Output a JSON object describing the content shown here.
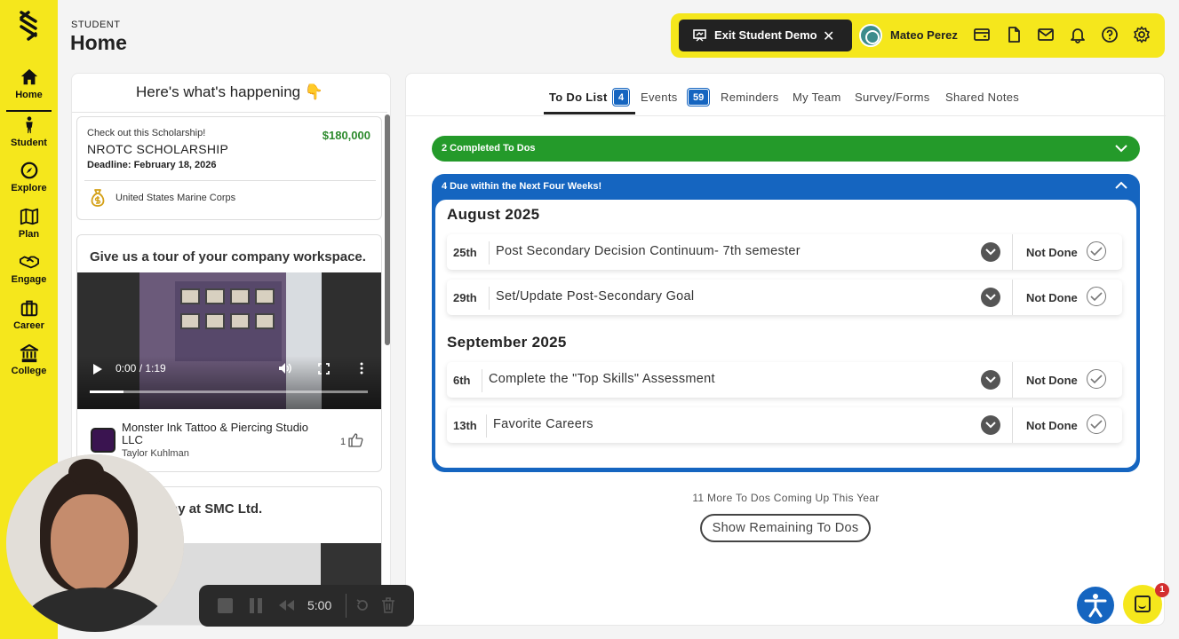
{
  "sidebar": {
    "items": [
      {
        "label": "Home",
        "icon": "home-icon"
      },
      {
        "label": "Student",
        "icon": "person-icon"
      },
      {
        "label": "Explore",
        "icon": "compass-icon"
      },
      {
        "label": "Plan",
        "icon": "map-icon"
      },
      {
        "label": "Engage",
        "icon": "handshake-icon"
      },
      {
        "label": "Career",
        "icon": "briefcase-icon"
      },
      {
        "label": "College",
        "icon": "building-icon"
      }
    ]
  },
  "header": {
    "section": "STUDENT",
    "title": "Home"
  },
  "topbar": {
    "exit_label": "Exit Student Demo",
    "user_name": "Mateo Perez"
  },
  "feed": {
    "title": "Here's what's happening 👇",
    "scholarship": {
      "kicker": "Check out this Scholarship!",
      "name": "NROTC SCHOLARSHIP",
      "deadline": "Deadline: February 18, 2026",
      "amount": "$180,000",
      "org": "United States Marine Corps"
    },
    "video1": {
      "title": "Give us a tour of your company workspace.",
      "time": "0:00 / 1:19",
      "progress": 0.12,
      "company": "Monster Ink Tattoo & Piercing Studio LLC",
      "author": "Taylor Kuhlman",
      "likes": "1"
    },
    "video2": {
      "title": "ypical workday at SMC Ltd."
    }
  },
  "tabs": [
    {
      "label": "To Do List",
      "badge": "4",
      "active": true
    },
    {
      "label": "Events",
      "badge": "59"
    },
    {
      "label": "Reminders"
    },
    {
      "label": "My Team"
    },
    {
      "label": "Survey/Forms"
    },
    {
      "label": "Shared Notes"
    }
  ],
  "todo": {
    "completed_label": "2 Completed To Dos",
    "due_label": "4 Due within the Next Four Weeks!",
    "months": [
      {
        "name": "August 2025",
        "items": [
          {
            "day": "25th",
            "title": "Post Secondary Decision Continuum- 7th semester",
            "status": "Not Done"
          },
          {
            "day": "29th",
            "title": "Set/Update Post-Secondary Goal",
            "status": "Not Done"
          }
        ]
      },
      {
        "name": "September 2025",
        "items": [
          {
            "day": "6th",
            "title": "Complete the \"Top Skills\" Assessment",
            "status": "Not Done"
          },
          {
            "day": "13th",
            "title": "Favorite Careers",
            "status": "Not Done"
          }
        ]
      }
    ],
    "more_text": "11 More To Dos Coming Up This Year",
    "show_button": "Show Remaining To Dos"
  },
  "recorder": {
    "timer": "5:00"
  },
  "chat": {
    "unread": "1"
  },
  "colors": {
    "brand_yellow": "#f5e71c",
    "accent_blue": "#1565c0",
    "completed_green": "#249a2a"
  }
}
